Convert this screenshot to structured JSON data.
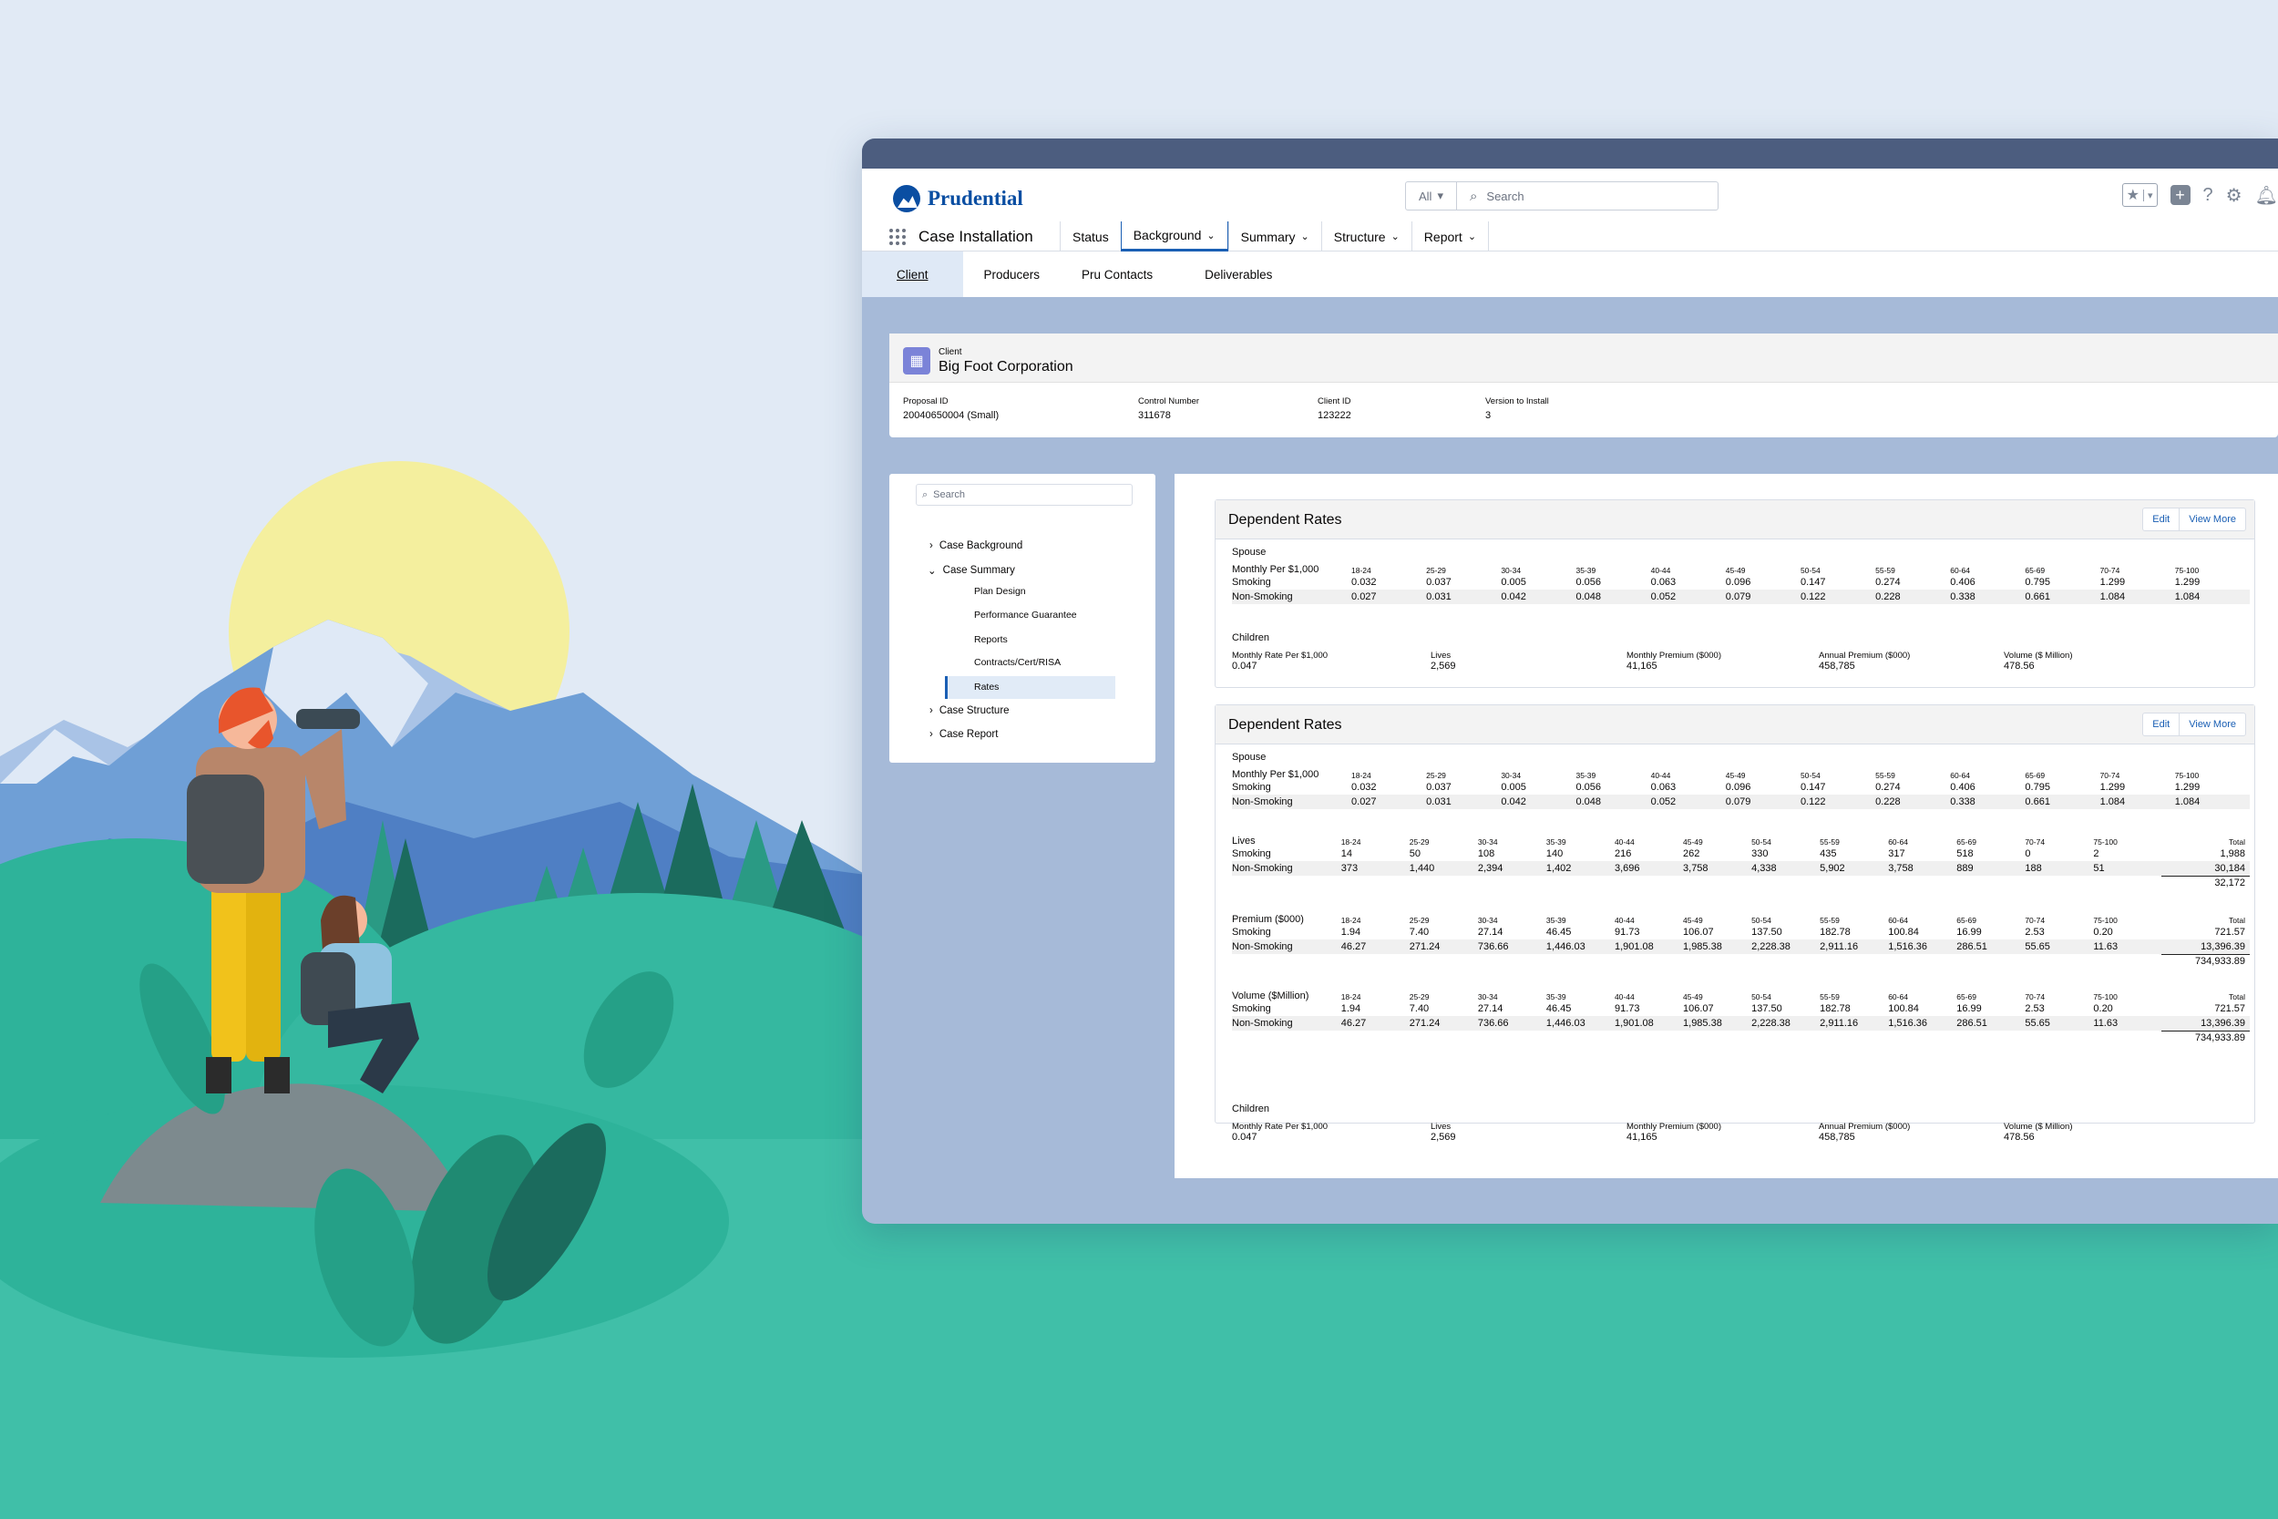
{
  "app": {
    "brand": "Prudential",
    "name": "Case Installation",
    "search_scope": "All",
    "search_placeholder": "Search"
  },
  "nav_tabs": [
    {
      "label": "Status",
      "dropdown": false
    },
    {
      "label": "Background",
      "dropdown": true
    },
    {
      "label": "Summary",
      "dropdown": true
    },
    {
      "label": "Structure",
      "dropdown": true
    },
    {
      "label": "Report",
      "dropdown": true
    }
  ],
  "sub_tabs": [
    "Client",
    "Producers",
    "Pru Contacts",
    "Deliverables"
  ],
  "client": {
    "label": "Client",
    "name": "Big Foot Corporation",
    "fields": [
      {
        "label": "Proposal ID",
        "value": "20040650004 (Small)"
      },
      {
        "label": "Control Number",
        "value": "311678"
      },
      {
        "label": "Client ID",
        "value": "123222"
      },
      {
        "label": "Version to Install",
        "value": "3"
      }
    ]
  },
  "tree": {
    "search_placeholder": "Search",
    "items": [
      "Case Background",
      "Case Summary",
      "Case Structure",
      "Case Report"
    ],
    "summary_children": [
      "Plan Design",
      "Performance Guarantee",
      "Reports",
      "Contracts/Cert/RISA",
      "Rates"
    ]
  },
  "cards": [
    {
      "title": "Dependent Rates",
      "edit": "Edit",
      "view_more": "View More",
      "spouse_label": "Spouse",
      "children_label": "Children"
    },
    {
      "title": "Dependent Rates",
      "edit": "Edit",
      "view_more": "View More",
      "spouse_label": "Spouse",
      "children_label": "Children"
    }
  ],
  "age_bands": [
    "18-24",
    "25-29",
    "30-34",
    "35-39",
    "40-44",
    "45-49",
    "50-54",
    "55-59",
    "60-64",
    "65-69",
    "70-74",
    "75-100"
  ],
  "spouse_rates": {
    "header": "Monthly Per $1,000",
    "rows": [
      {
        "label": "Smoking",
        "values": [
          "0.032",
          "0.037",
          "0.005",
          "0.056",
          "0.063",
          "0.096",
          "0.147",
          "0.274",
          "0.406",
          "0.795",
          "1.299",
          "1.299"
        ]
      },
      {
        "label": "Non-Smoking",
        "values": [
          "0.027",
          "0.031",
          "0.042",
          "0.048",
          "0.052",
          "0.079",
          "0.122",
          "0.228",
          "0.338",
          "0.661",
          "1.084",
          "1.084"
        ]
      }
    ]
  },
  "children": [
    {
      "label": "Monthly Rate Per $1,000",
      "value": "0.047"
    },
    {
      "label": "Lives",
      "value": "2,569"
    },
    {
      "label": "Monthly Premium ($000)",
      "value": "41,165"
    },
    {
      "label": "Annual  Premium ($000)",
      "value": "458,785"
    },
    {
      "label": "Volume ($ Million)",
      "value": "478.56"
    }
  ],
  "total_label": "Total",
  "lives_table": {
    "header": "Lives",
    "rows": [
      {
        "label": "Smoking",
        "values": [
          "14",
          "50",
          "108",
          "140",
          "216",
          "262",
          "330",
          "435",
          "317",
          "518",
          "0",
          "2"
        ],
        "total": "1,988"
      },
      {
        "label": "Non-Smoking",
        "values": [
          "373",
          "1,440",
          "2,394",
          "1,402",
          "3,696",
          "3,758",
          "4,338",
          "5,902",
          "3,758",
          "889",
          "188",
          "51"
        ],
        "total": "30,184"
      }
    ],
    "grand_total": "32,172"
  },
  "premium_table": {
    "header": "Premium ($000)",
    "rows": [
      {
        "label": "Smoking",
        "values": [
          "1.94",
          "7.40",
          "27.14",
          "46.45",
          "91.73",
          "106.07",
          "137.50",
          "182.78",
          "100.84",
          "16.99",
          "2.53",
          "0.20"
        ],
        "total": "721.57"
      },
      {
        "label": "Non-Smoking",
        "values": [
          "46.27",
          "271.24",
          "736.66",
          "1,446.03",
          "1,901.08",
          "1,985.38",
          "2,228.38",
          "2,911.16",
          "1,516.36",
          "286.51",
          "55.65",
          "11.63"
        ],
        "total": "13,396.39"
      }
    ],
    "grand_total": "734,933.89"
  },
  "volume_table": {
    "header": "Volume ($Million)",
    "rows": [
      {
        "label": "Smoking",
        "values": [
          "1.94",
          "7.40",
          "27.14",
          "46.45",
          "91.73",
          "106.07",
          "137.50",
          "182.78",
          "100.84",
          "16.99",
          "2.53",
          "0.20"
        ],
        "total": "721.57"
      },
      {
        "label": "Non-Smoking",
        "values": [
          "46.27",
          "271.24",
          "736.66",
          "1,446.03",
          "1,901.08",
          "1,985.38",
          "2,228.38",
          "2,911.16",
          "1,516.36",
          "286.51",
          "55.65",
          "11.63"
        ],
        "total": "13,396.39"
      }
    ],
    "grand_total": "734,933.89"
  },
  "colors": {
    "titlebar": "#4c5d7f",
    "window_bg": "#a6bad8",
    "page_bg": "#e1eaf5",
    "accent": "#1a5fb4",
    "ground": "#40bfa8"
  },
  "icons": [
    "prudential-rock-logo",
    "search-icon",
    "favorites-star-icon",
    "add-icon",
    "help-icon",
    "gear-icon",
    "bell-icon",
    "app-launcher-icon",
    "building-icon",
    "chevron-right-icon",
    "chevron-down-icon"
  ]
}
